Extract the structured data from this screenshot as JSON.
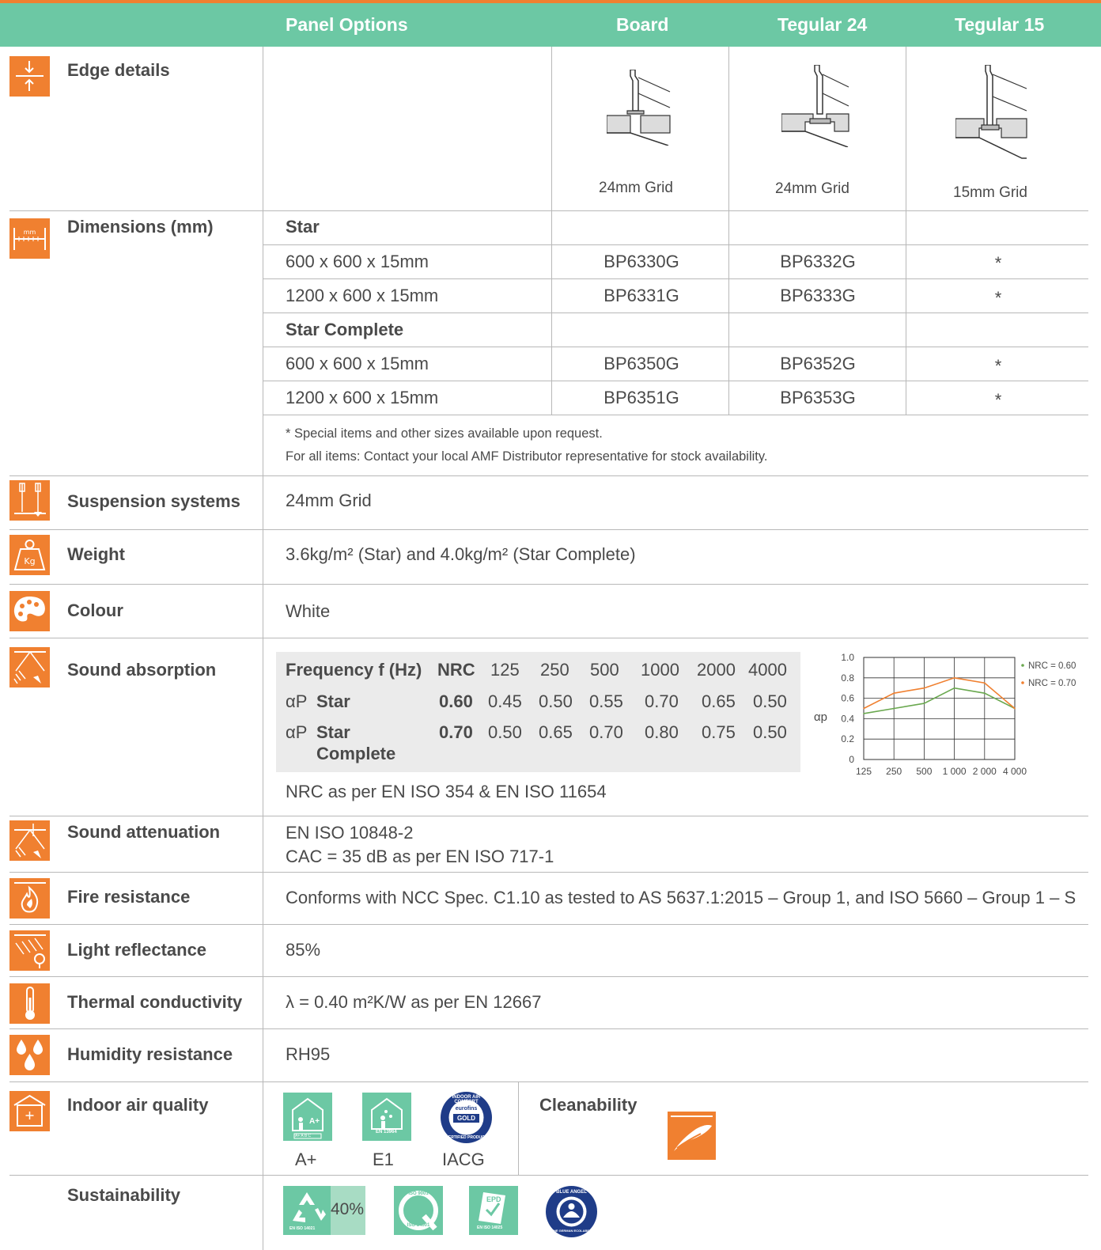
{
  "header": {
    "panel_options": "Panel Options",
    "board": "Board",
    "tegular24": "Tegular 24",
    "tegular15": "Tegular 15"
  },
  "edge": {
    "label": "Edge details",
    "board_caption": "24mm Grid",
    "tegular24_caption": "24mm Grid",
    "tegular15_caption": "15mm Grid"
  },
  "dimensions": {
    "label": "Dimensions (mm)",
    "group1": "Star",
    "group2": "Star Complete",
    "rows": [
      {
        "size": "600 x 600  x 15mm",
        "board": "BP6330G",
        "t24": "BP6332G",
        "t15": "*"
      },
      {
        "size": "1200 x 600  x 15mm",
        "board": "BP6331G",
        "t24": "BP6333G",
        "t15": "*"
      },
      {
        "size": "600 x 600  x 15mm",
        "board": "BP6350G",
        "t24": "BP6352G",
        "t15": "*"
      },
      {
        "size": "1200 x 600  x 15mm",
        "board": "BP6351G",
        "t24": "BP6353G",
        "t15": "*"
      }
    ],
    "note1": "* Special items and other sizes available upon request.",
    "note2": "For all items: Contact your local AMF Distributor  representative for stock availability."
  },
  "suspension": {
    "label": "Suspension systems",
    "value": "24mm Grid"
  },
  "weight": {
    "label": "Weight",
    "value": "3.6kg/m² (Star) and 4.0kg/m² (Star Complete)"
  },
  "colour": {
    "label": "Colour",
    "value": "White"
  },
  "sound_absorption": {
    "label": "Sound absorption",
    "headers": [
      "Frequency f (Hz)",
      "NRC",
      "125",
      "250",
      "500",
      "1000",
      "2000",
      "4000"
    ],
    "row1_prefix": "αP",
    "row1_name": "Star",
    "row1_values": [
      "0.60",
      "0.45",
      "0.50",
      "0.55",
      "0.70",
      "0.65",
      "0.50"
    ],
    "row2_prefix": "αP",
    "row2_name_a": "Star",
    "row2_name_b": "Complete",
    "row2_values": [
      "0.70",
      "0.50",
      "0.65",
      "0.70",
      "0.80",
      "0.75",
      "0.50"
    ],
    "footnote": "NRC as per EN ISO 354 & EN ISO 11654"
  },
  "chart_data": {
    "type": "line",
    "x": [
      "125",
      "250",
      "500",
      "1 000",
      "2 000",
      "4 000"
    ],
    "series": [
      {
        "name": "NRC = 0.60",
        "color": "#6aa84f",
        "values": [
          0.45,
          0.5,
          0.55,
          0.7,
          0.65,
          0.5
        ]
      },
      {
        "name": "NRC = 0.70",
        "color": "#f08030",
        "values": [
          0.5,
          0.65,
          0.7,
          0.8,
          0.75,
          0.5
        ]
      }
    ],
    "ylabel": "αp",
    "ylim": [
      0,
      1.0
    ],
    "yticks": [
      "0",
      "0.2",
      "0.4",
      "0.6",
      "0.8",
      "1.0"
    ],
    "grid": true,
    "legend": "top-right"
  },
  "sound_attenuation": {
    "label": "Sound attenuation",
    "line1": "EN ISO 10848-2",
    "line2": "CAC = 35 dB as per EN ISO 717-1"
  },
  "fire": {
    "label": "Fire resistance",
    "value": "Conforms with NCC Spec. C1.10 as tested to AS 5637.1:2015 – Group 1, and ISO 5660 – Group 1 – S"
  },
  "light": {
    "label": "Light reflectance",
    "value": "85%"
  },
  "thermal": {
    "label": "Thermal conductivity",
    "value": "λ = 0.40 m²K/W as per EN 12667"
  },
  "humidity": {
    "label": "Humidity resistance",
    "value": "RH95"
  },
  "indoor": {
    "label": "Indoor air quality",
    "badge1": "A+",
    "badge2": "E1",
    "badge3": "IACG",
    "badge1_text": "A+",
    "badge1_scale": "A+ A B C",
    "badge2_text": "EN 13964",
    "badge3_ring": "INDOOR AIR COMFORT",
    "badge3_brand": "eurofins",
    "badge3_gold": "GOLD",
    "badge3_bottom": "CERTIFIED PRODUCT",
    "cleanability": "Cleanability"
  },
  "sustainability": {
    "label": "Sustainability",
    "recycled": "40%",
    "iso14021": "EN ISO 14021",
    "iso_ring_top": "ISO 9001",
    "iso_ring_bottom": "ISO 14001",
    "epd": "EPD",
    "epd_std": "EN ISO 14025",
    "blue_angel": "BLUE ANGEL",
    "blue_angel_sub": "THE GERMAN ECOLABEL"
  },
  "colors": {
    "header": "#6cc8a4",
    "accent": "#f08030",
    "table_bg": "#ebebeb"
  }
}
